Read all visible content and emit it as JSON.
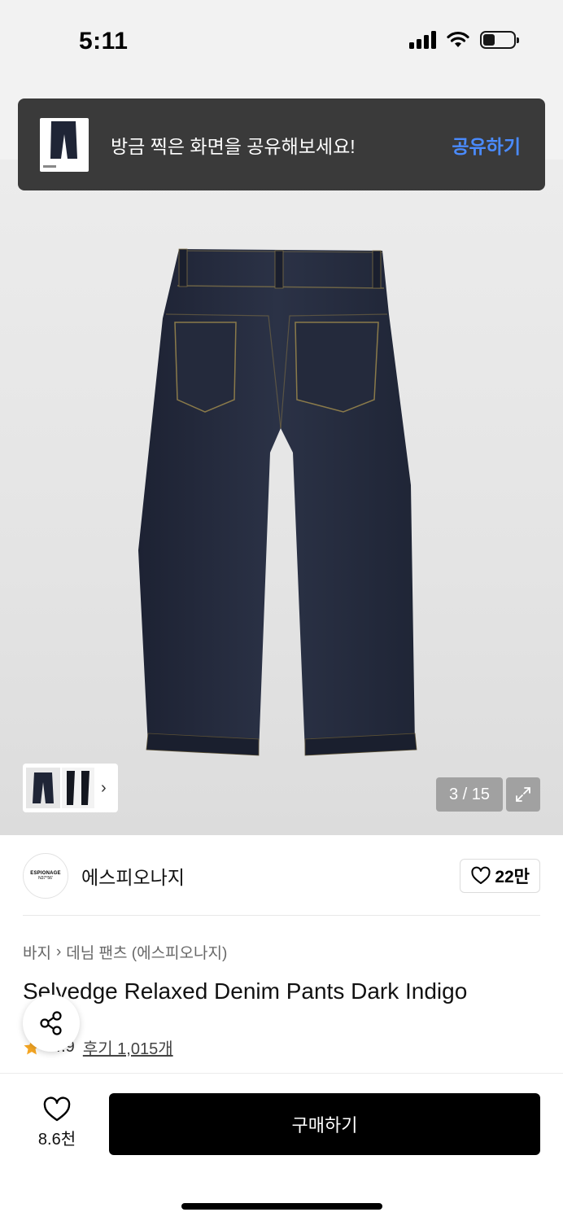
{
  "status_bar": {
    "time": "5:11"
  },
  "toast": {
    "message": "방금 찍은 화면을 공유해보세요!",
    "action_label": "공유하기"
  },
  "gallery": {
    "counter": "3 / 15"
  },
  "brand": {
    "logo_text_line1": "ESPIONAGE",
    "logo_text_line2": "N37°56'",
    "name": "에스피오나지",
    "likes": "22만"
  },
  "breadcrumb": {
    "level1": "바지",
    "level2": "데님 팬츠 (에스피오나지)"
  },
  "product": {
    "title": "Selvedge Relaxed Denim Pants Dark Indigo",
    "rating": "4.9",
    "reviews": "후기 1,015개"
  },
  "bottom_bar": {
    "wish_count": "8.6천",
    "buy_label": "구매하기"
  },
  "colors": {
    "accent_link": "#4a8bff",
    "star": "#f5a623",
    "denim": "#242a3a"
  }
}
